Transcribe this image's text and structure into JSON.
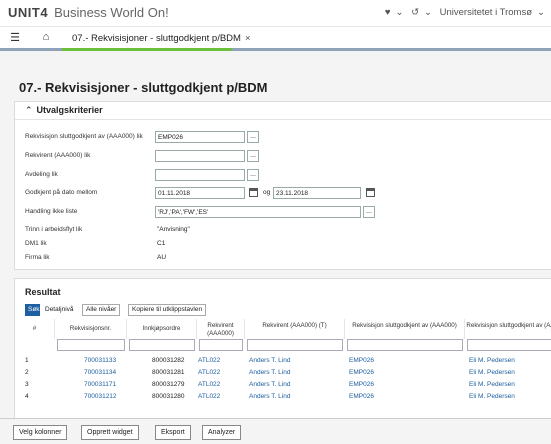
{
  "app": {
    "logo_text": "UNIT4",
    "logo_sub": "Business World On!",
    "org": "Universitetet i Tromsø",
    "icons": [
      "heart-icon",
      "chevron-down-icon",
      "history-icon",
      "chevron-down-icon"
    ]
  },
  "tabs": {
    "active_label": "07.- Rekvisisjoner - sluttgodkjent p/BDM",
    "close": "×"
  },
  "page": {
    "title": "07.- Rekvisisjoner - sluttgodkjent p/BDM"
  },
  "criteria": {
    "header": "Utvalgskriterier",
    "fields": [
      {
        "label": "Rekvisisjon sluttgodkjent av (AAA000) lik",
        "value": "EMP026"
      },
      {
        "label": "Rekvirent (AAA000) lik",
        "value": ""
      },
      {
        "label": "Avdeling lik",
        "value": ""
      },
      {
        "label": "Godkjent på dato mellom",
        "value": "01.11.2018",
        "og": "og",
        "value2": "23.11.2018"
      },
      {
        "label": "Handling ikke liste",
        "value": "'RJ','PA','FW','ES'"
      },
      {
        "label": "Trinn i arbeidsflyt lik",
        "value": "\"Anvisning\""
      },
      {
        "label": "DM1 lik",
        "value": "C1"
      },
      {
        "label": "Firma lik",
        "value": "AU"
      }
    ],
    "ellipsis": "..."
  },
  "results": {
    "header": "Resultat",
    "buttons": {
      "search": "Søk",
      "detail": "Detaljnivå",
      "all_levels": "Alle nivåer",
      "copy": "Kopiere til utklippstavlen"
    },
    "columns": [
      "#",
      "Rekvisisjonsnr.",
      "Innkjøpsordre",
      "Rekvirent (AAA000)",
      "Rekvirent (AAA000) (T)",
      "Rekvisisjon sluttgodkjent av (AAA000)",
      "Rekvisisjon sluttgodkjent av (AAA"
    ],
    "rows": [
      {
        "n": "1",
        "rek": "700031133",
        "po": "800031282",
        "rid": "ATL022",
        "rname": "Anders T. Lind",
        "sid": "EMP026",
        "sname": "Eli M. Pedersen"
      },
      {
        "n": "2",
        "rek": "700031134",
        "po": "800031281",
        "rid": "ATL022",
        "rname": "Anders T. Lind",
        "sid": "EMP026",
        "sname": "Eli M. Pedersen"
      },
      {
        "n": "3",
        "rek": "700031171",
        "po": "800031279",
        "rid": "ATL022",
        "rname": "Anders T. Lind",
        "sid": "EMP026",
        "sname": "Eli M. Pedersen"
      },
      {
        "n": "4",
        "rek": "700031212",
        "po": "800031280",
        "rid": "ATL022",
        "rname": "Anders T. Lind",
        "sid": "EMP026",
        "sname": "Eli M. Pedersen"
      }
    ]
  },
  "footer": {
    "buttons": [
      "Velg kolonner",
      "Opprett widget",
      "Eksport",
      "Analyzer"
    ]
  },
  "colors": {
    "accent": "#1d5fa0",
    "green": "#6bbf3a",
    "nav": "#8ea3b6"
  }
}
